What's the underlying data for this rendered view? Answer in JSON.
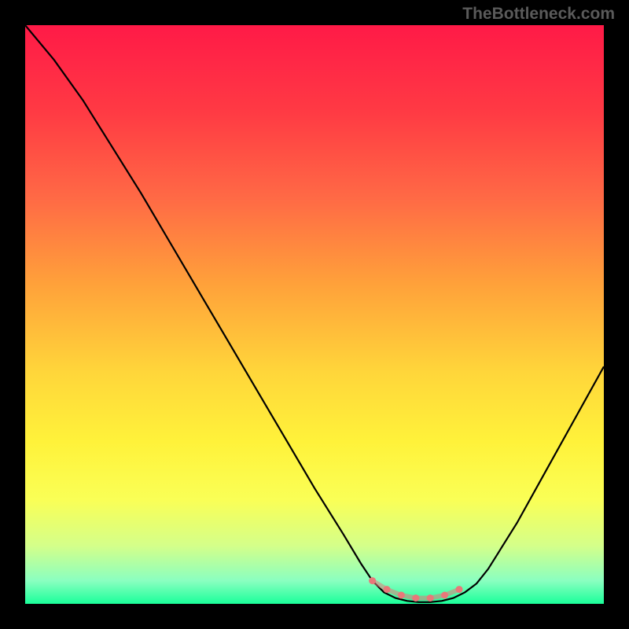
{
  "watermark": "TheBottleneck.com",
  "chart_data": {
    "type": "line",
    "title": "",
    "xlabel": "",
    "ylabel": "",
    "x_range": [
      0,
      100
    ],
    "y_range": [
      0,
      100
    ],
    "background_gradient": {
      "type": "vertical",
      "stops": [
        {
          "pos": 0.0,
          "color": "#ff1a47"
        },
        {
          "pos": 0.15,
          "color": "#ff3a44"
        },
        {
          "pos": 0.3,
          "color": "#ff6a45"
        },
        {
          "pos": 0.45,
          "color": "#ffa23a"
        },
        {
          "pos": 0.6,
          "color": "#ffd63a"
        },
        {
          "pos": 0.72,
          "color": "#fff23a"
        },
        {
          "pos": 0.82,
          "color": "#faff56"
        },
        {
          "pos": 0.9,
          "color": "#d4ff8a"
        },
        {
          "pos": 0.96,
          "color": "#8affc0"
        },
        {
          "pos": 1.0,
          "color": "#1aff9a"
        }
      ]
    },
    "series": [
      {
        "name": "bottleneck-curve",
        "color": "#000000",
        "points": [
          {
            "x": 0.0,
            "y": 100.0
          },
          {
            "x": 5.0,
            "y": 94.0
          },
          {
            "x": 10.0,
            "y": 87.0
          },
          {
            "x": 15.0,
            "y": 79.0
          },
          {
            "x": 20.0,
            "y": 71.0
          },
          {
            "x": 25.0,
            "y": 62.5
          },
          {
            "x": 30.0,
            "y": 54.0
          },
          {
            "x": 35.0,
            "y": 45.5
          },
          {
            "x": 40.0,
            "y": 37.0
          },
          {
            "x": 45.0,
            "y": 28.5
          },
          {
            "x": 50.0,
            "y": 20.0
          },
          {
            "x": 55.0,
            "y": 12.0
          },
          {
            "x": 58.0,
            "y": 7.0
          },
          {
            "x": 60.0,
            "y": 4.0
          },
          {
            "x": 62.0,
            "y": 2.0
          },
          {
            "x": 64.0,
            "y": 1.0
          },
          {
            "x": 66.0,
            "y": 0.5
          },
          {
            "x": 68.0,
            "y": 0.3
          },
          {
            "x": 70.0,
            "y": 0.3
          },
          {
            "x": 72.0,
            "y": 0.5
          },
          {
            "x": 74.0,
            "y": 1.0
          },
          {
            "x": 76.0,
            "y": 2.0
          },
          {
            "x": 78.0,
            "y": 3.5
          },
          {
            "x": 80.0,
            "y": 6.0
          },
          {
            "x": 85.0,
            "y": 14.0
          },
          {
            "x": 90.0,
            "y": 23.0
          },
          {
            "x": 95.0,
            "y": 32.0
          },
          {
            "x": 100.0,
            "y": 41.0
          }
        ]
      },
      {
        "name": "optimal-range-marker",
        "color": "#e8787a",
        "style": "dots",
        "points": [
          {
            "x": 60.0,
            "y": 4.0
          },
          {
            "x": 62.5,
            "y": 2.5
          },
          {
            "x": 65.0,
            "y": 1.5
          },
          {
            "x": 67.5,
            "y": 1.0
          },
          {
            "x": 70.0,
            "y": 1.0
          },
          {
            "x": 72.5,
            "y": 1.5
          },
          {
            "x": 75.0,
            "y": 2.5
          }
        ]
      }
    ]
  }
}
